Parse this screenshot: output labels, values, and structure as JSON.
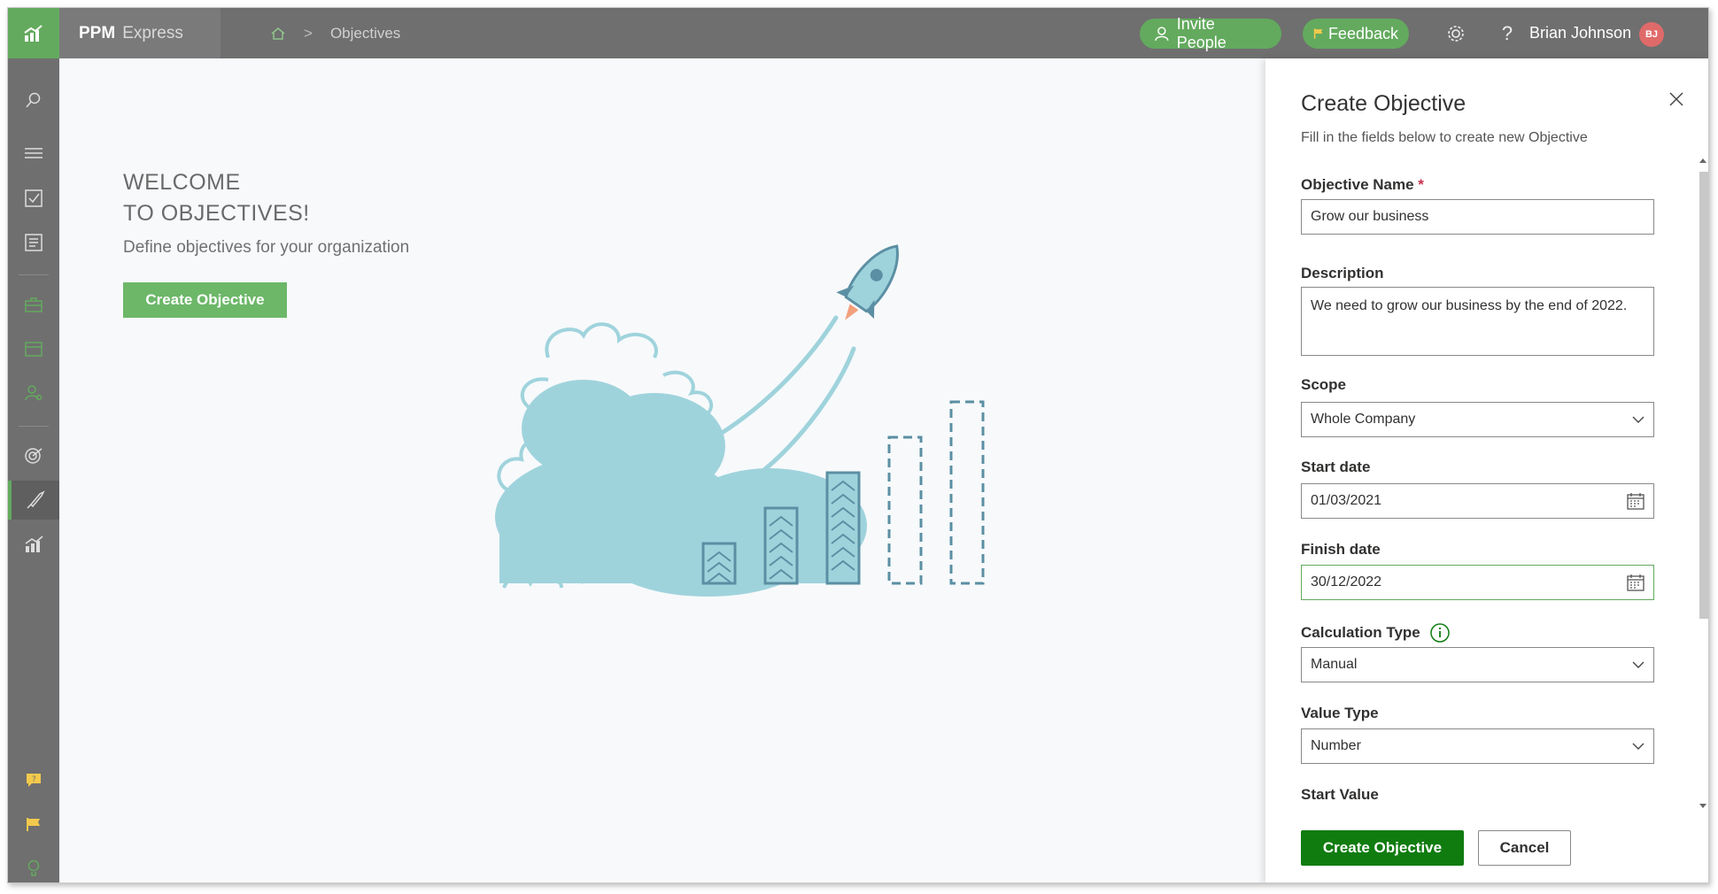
{
  "app": {
    "brand_main": "PPM",
    "brand_sub": "Express"
  },
  "breadcrumb": {
    "current": "Objectives"
  },
  "header": {
    "invite_label": "Invite People",
    "feedback_label": "Feedback",
    "user_name": "Brian Johnson",
    "user_initials": "BJ"
  },
  "welcome": {
    "line1": "WELCOME",
    "line2": "TO OBJECTIVES!",
    "subtitle": "Define objectives for your organization",
    "button_label": "Create Objective"
  },
  "panel": {
    "title": "Create Objective",
    "subtitle": "Fill in the fields below to create new Objective",
    "fields": {
      "name_label": "Objective Name",
      "name_required": "*",
      "name_value": "Grow our business",
      "description_label": "Description",
      "description_value": "We need to grow our business by the end of 2022.",
      "scope_label": "Scope",
      "scope_value": "Whole Company",
      "start_label": "Start date",
      "start_value": "01/03/2021",
      "finish_label": "Finish date",
      "finish_value": "30/12/2022",
      "calc_label": "Calculation Type",
      "calc_value": "Manual",
      "valuetype_label": "Value Type",
      "valuetype_value": "Number",
      "startvalue_label": "Start Value"
    },
    "create_label": "Create Objective",
    "cancel_label": "Cancel"
  },
  "colors": {
    "brand_green": "#63aa5e",
    "primary_green": "#107c10",
    "topbar": "#6f6f6f",
    "illustration": "#9fd3dc"
  }
}
